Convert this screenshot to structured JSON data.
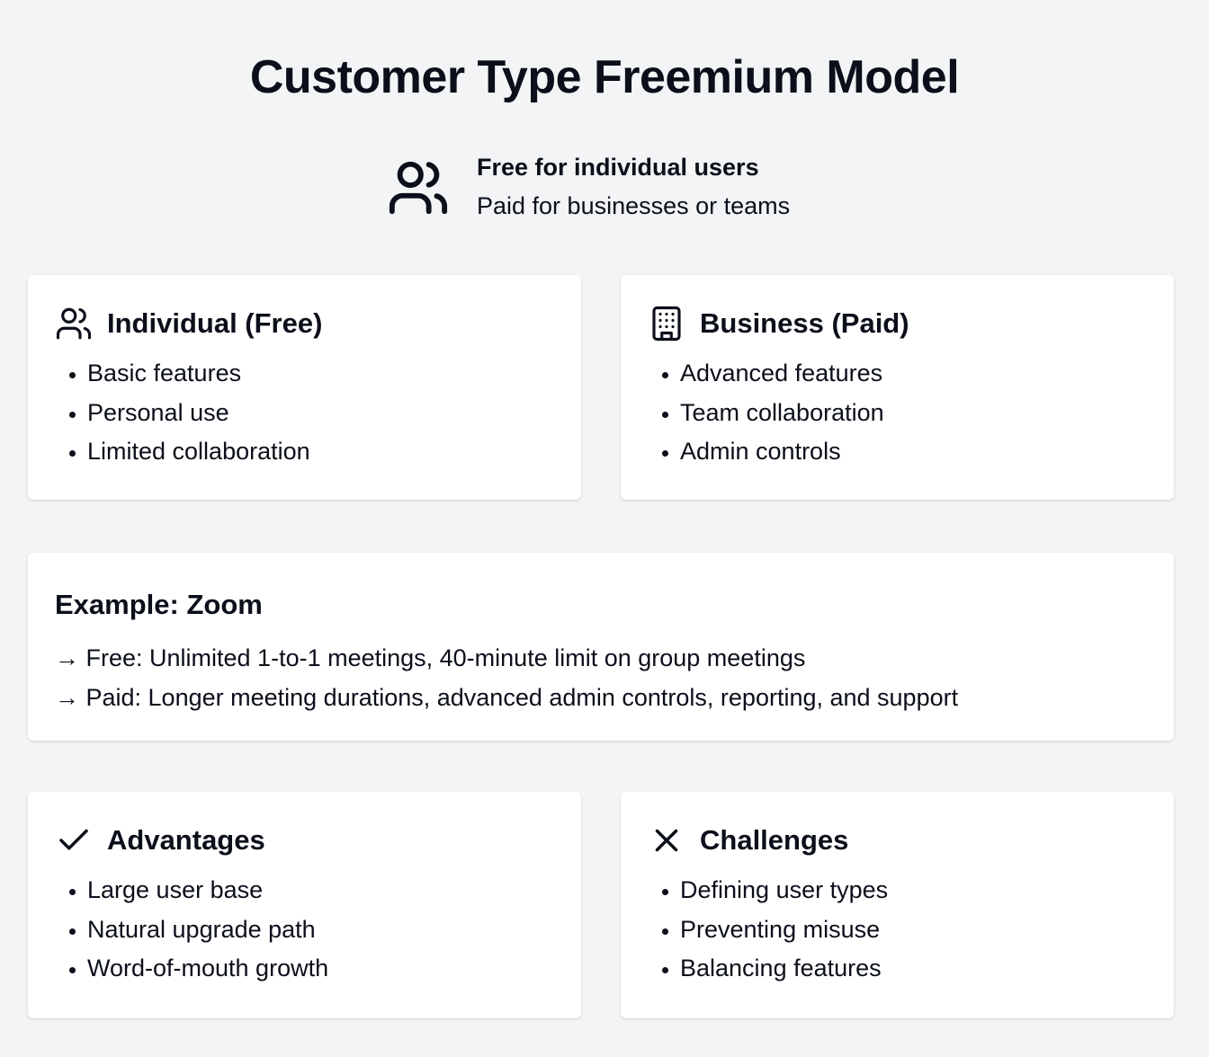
{
  "title": "Customer Type Freemium Model",
  "subtitle": {
    "icon": "users-icon",
    "line1": "Free for individual users",
    "line2": "Paid for businesses or teams"
  },
  "cards": {
    "individual": {
      "icon": "users-icon",
      "title": "Individual (Free)",
      "items": [
        "Basic features",
        "Personal use",
        "Limited collaboration"
      ]
    },
    "business": {
      "icon": "building-icon",
      "title": "Business (Paid)",
      "items": [
        "Advanced features",
        "Team collaboration",
        "Admin controls"
      ]
    },
    "example": {
      "title": "Example: Zoom",
      "lines": [
        "→ Free: Unlimited 1-to-1 meetings, 40-minute limit on group meetings",
        "→ Paid: Longer meeting durations, advanced admin controls, reporting, and support"
      ]
    },
    "advantages": {
      "icon": "check-icon",
      "title": "Advantages",
      "items": [
        "Large user base",
        "Natural upgrade path",
        "Word-of-mouth growth"
      ]
    },
    "challenges": {
      "icon": "x-icon",
      "title": "Challenges",
      "items": [
        "Defining user types",
        "Preventing misuse",
        "Balancing features"
      ]
    }
  },
  "colors": {
    "background": "#f3f4f6",
    "card": "#ffffff",
    "text": "#0b0f1a"
  }
}
